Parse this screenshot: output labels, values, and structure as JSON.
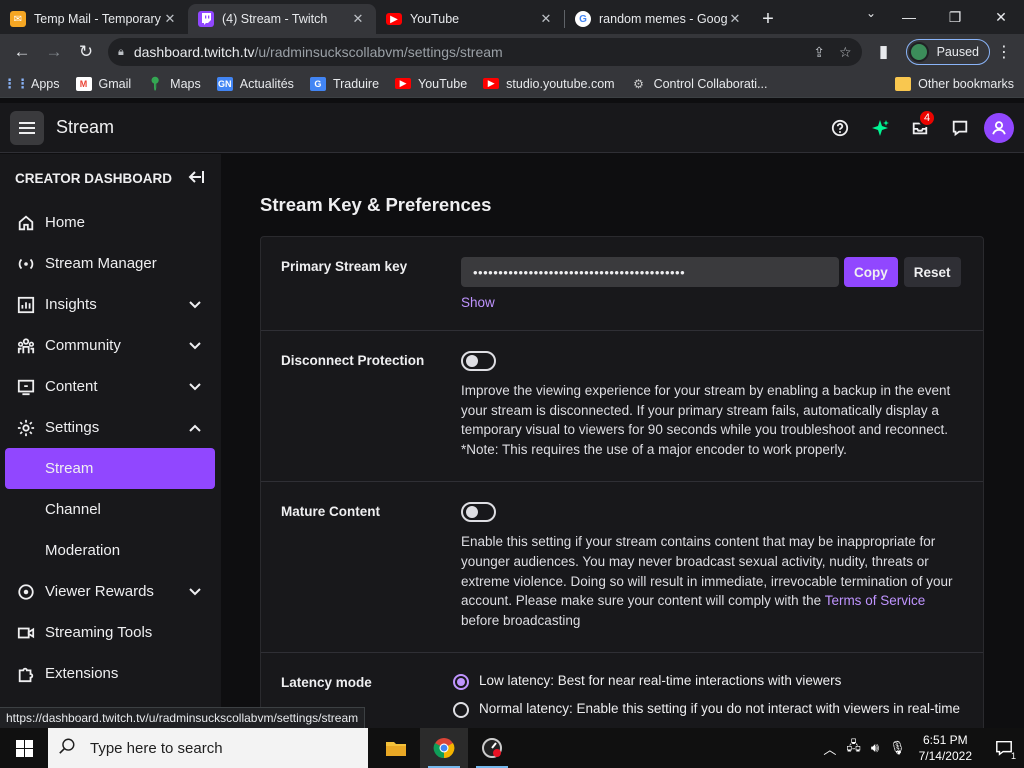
{
  "browser": {
    "tabs": [
      {
        "title": "Temp Mail - Temporary",
        "fav_color": "#f5a623"
      },
      {
        "title": "(4) Stream - Twitch",
        "fav_color": "#9147ff"
      },
      {
        "title": "YouTube",
        "fav_color": "#ff0000"
      },
      {
        "title": "random memes - Goog",
        "fav_color": "#ffffff"
      }
    ],
    "url_host": "dashboard.twitch.tv",
    "url_path": "/u/radminsuckscollabvm/settings/stream",
    "profile_label": "Paused",
    "bookmarks": [
      "Apps",
      "Gmail",
      "Maps",
      "Actualités",
      "Traduire",
      "YouTube",
      "studio.youtube.com",
      "Control Collaborati...",
      "Other bookmarks"
    ],
    "status_url": "https://dashboard.twitch.tv/u/radminsuckscollabvm/settings/stream"
  },
  "topnav": {
    "title": "Stream",
    "inbox_badge": "4",
    "accent": "#9147ff"
  },
  "sidebar": {
    "heading": "CREATOR DASHBOARD",
    "items": [
      {
        "label": "Home"
      },
      {
        "label": "Stream Manager"
      },
      {
        "label": "Insights"
      },
      {
        "label": "Community"
      },
      {
        "label": "Content"
      },
      {
        "label": "Settings"
      },
      {
        "label": "Stream"
      },
      {
        "label": "Channel"
      },
      {
        "label": "Moderation"
      },
      {
        "label": "Viewer Rewards"
      },
      {
        "label": "Streaming Tools"
      },
      {
        "label": "Extensions"
      }
    ]
  },
  "main": {
    "heading": "Stream Key & Preferences",
    "stream_key": {
      "label": "Primary Stream key",
      "masked_value": "••••••••••••••••••••••••••••••••••••••••••",
      "copy_label": "Copy",
      "reset_label": "Reset",
      "show_label": "Show"
    },
    "disconnect": {
      "label": "Disconnect Protection",
      "enabled": false,
      "desc": "Improve the viewing experience for your stream by enabling a backup in the event your stream is disconnected. If your primary stream fails, automatically display a temporary visual to viewers for 90 seconds while you troubleshoot and reconnect. *Note: This requires the use of a major encoder to work properly."
    },
    "mature": {
      "label": "Mature Content",
      "enabled": false,
      "desc": "Enable this setting if your stream contains content that may be inappropriate for younger audiences. You may never broadcast sexual activity, nudity, threats or extreme violence. Doing so will result in immediate, irrevocable termination of your account. Please make sure your content will comply with the",
      "tos_link": "Terms of Service",
      "desc_tail": " before broadcasting"
    },
    "latency": {
      "label": "Latency mode",
      "options": [
        {
          "label": "Low latency: Best for near real-time interactions with viewers",
          "selected": true
        },
        {
          "label": "Normal latency: Enable this setting if you do not interact with viewers in real-time",
          "selected": false
        }
      ]
    }
  },
  "taskbar": {
    "search_placeholder": "Type here to search",
    "time": "6:51 PM",
    "date": "7/14/2022",
    "notif_count": "1"
  }
}
